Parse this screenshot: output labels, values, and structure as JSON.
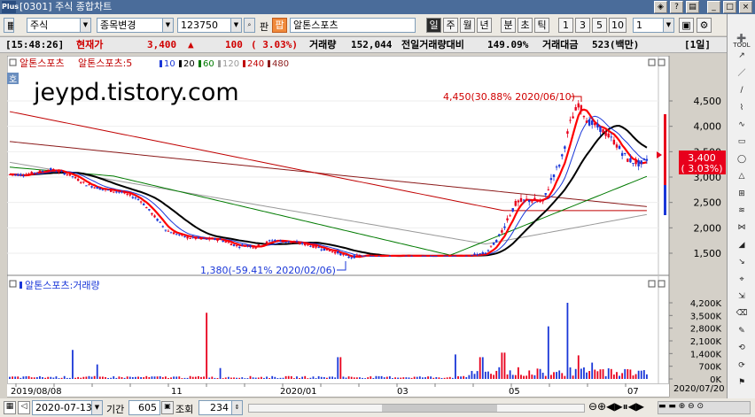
{
  "window": {
    "title": "[0301] 주식 종합차트",
    "logo": "Plus"
  },
  "toolbar": {
    "market_select": "주식",
    "change_select": "종목변경",
    "code_input": "123750",
    "pan_label": "판",
    "ji_label": "팝",
    "stock_name": "알톤스포츠",
    "period_buttons": [
      "일",
      "주",
      "월",
      "년",
      "분",
      "초",
      "틱"
    ],
    "number_buttons": [
      "1",
      "3",
      "5",
      "10"
    ],
    "interval_value": "1",
    "save_icon": "disk-icon",
    "settings_icon": "gear-icon"
  },
  "info": {
    "time": "[15:48:26]",
    "price_label": "현재가",
    "price": "3,400",
    "arrow": "▲",
    "change": "100",
    "change_pct": "( 3.03%)",
    "volume_label": "거래량",
    "volume": "152,044",
    "prev_vol_label": "전일거래량대비",
    "prev_vol": "149.09%",
    "amount_label": "거래대금",
    "amount": "523(백만)",
    "page": "[1일]"
  },
  "price_panel": {
    "legend_name": "알톤스포츠",
    "legend_ma_label": "알톤스포츠:5",
    "legend_mas": [
      "10",
      "20",
      "60",
      "120",
      "240",
      "480"
    ],
    "watermark": "jeypd.tistory.com",
    "high_note": "4,450(30.88% 2020/06/10)",
    "low_note": "1,380(-59.41% 2020/02/06)",
    "current_price_tag": "3,400",
    "current_pct_tag": "( 3.03%)",
    "y_labels": [
      "4,500",
      "4,000",
      "3,500",
      "3,000",
      "2,500",
      "2,000",
      "1,500"
    ],
    "corner_label": "호"
  },
  "volume_panel": {
    "legend": "알톤스포츠:거래량",
    "y_labels": [
      "4,200K",
      "3,500K",
      "2,800K",
      "2,100K",
      "1,400K",
      "700K",
      "0K"
    ]
  },
  "date_axis": {
    "labels": [
      "2019/08/08",
      "11",
      "2020/01",
      "03",
      "05",
      "07"
    ],
    "end_label": "2020/07/20"
  },
  "bottom": {
    "date_value": "2020-07-13",
    "period_label": "기간",
    "period_value": "605",
    "view_label": "조회",
    "view_value": "234"
  },
  "right_toolbar": [
    "TOOL",
    "",
    "",
    "",
    "",
    "",
    "",
    "",
    "",
    "",
    "",
    "",
    "",
    "",
    "",
    "",
    "ERASE",
    "DRAW",
    "",
    "",
    ""
  ],
  "colors": {
    "up": "#e8001c",
    "down": "#1a37d8",
    "ma5": "#ff0000",
    "ma20": "#000000",
    "ma60": "#007a00",
    "ma120": "#999999",
    "ma240": "#c00000",
    "ma480": "#8b1a1a"
  }
}
